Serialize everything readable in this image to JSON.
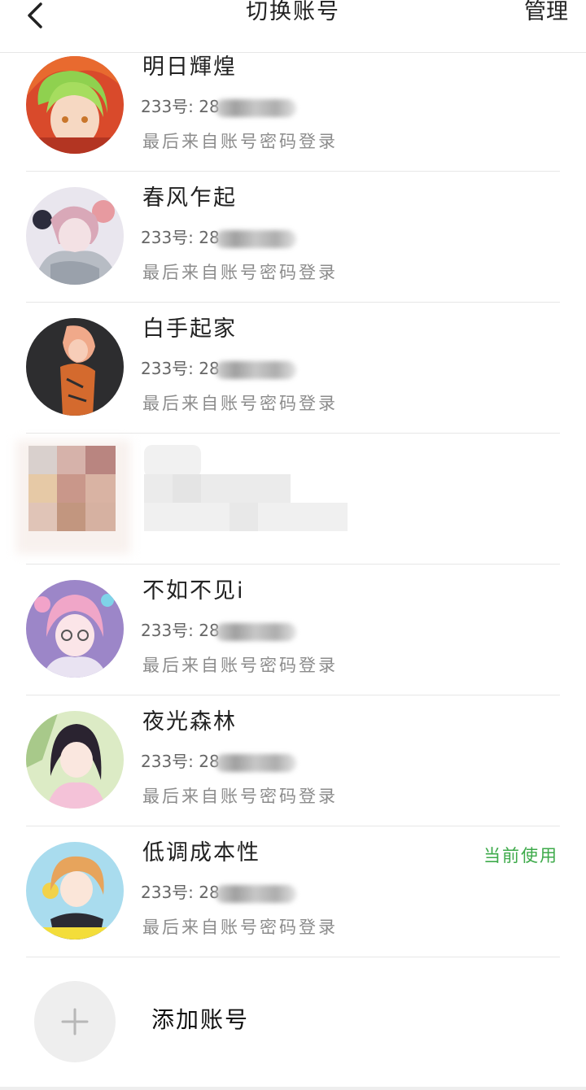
{
  "header": {
    "title": "切换账号",
    "manage_label": "管理"
  },
  "accounts": [
    {
      "name": "明日輝煌",
      "uid": "233号: 28",
      "login": "最后来自账号密码登录",
      "current": "",
      "avatar": "green-hair-avatar"
    },
    {
      "name": "春风乍起",
      "uid": "233号: 28",
      "login": "最后来自账号密码登录",
      "current": "",
      "avatar": "pink-hair-avatar"
    },
    {
      "name": "白手起家",
      "uid": "233号: 28",
      "login": "最后来自账号密码登录",
      "current": "",
      "avatar": "orange-hair-avatar"
    },
    {
      "name": "",
      "uid": "",
      "login": "",
      "current": "",
      "avatar": "pixelated-row"
    },
    {
      "name": "不如不见i",
      "uid": "233号: 28",
      "login": "最后来自账号密码登录",
      "current": "",
      "avatar": "lavender-hair-avatar"
    },
    {
      "name": "夜光森林",
      "uid": "233号: 28",
      "login": "最后来自账号密码登录",
      "current": "",
      "avatar": "dark-hair-avatar"
    },
    {
      "name": "低调成本性",
      "uid": "233号: 28",
      "login": "最后来自账号密码登录",
      "current": "当前使用",
      "avatar": "blonde-hair-avatar"
    }
  ],
  "add_account": {
    "label": "添加账号",
    "icon": "plus-icon"
  },
  "colors": {
    "current_badge": "#3daa4a",
    "secondary_text": "#8c8c8c",
    "divider": "#e7e7e7"
  }
}
